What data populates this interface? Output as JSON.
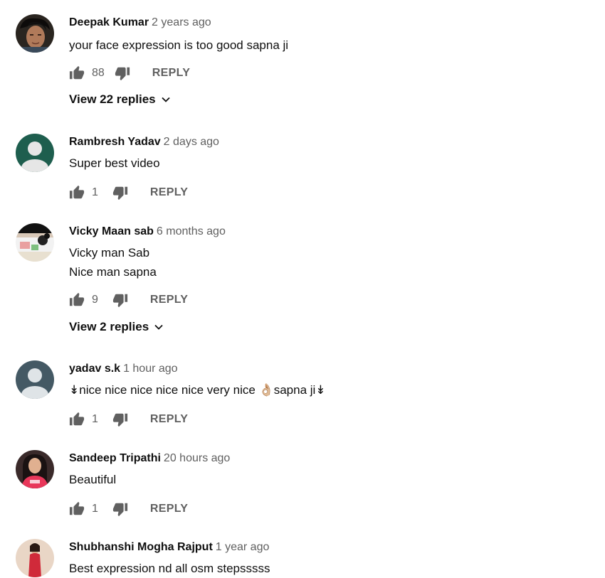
{
  "comments": [
    {
      "author": "Deepak Kumar",
      "time": "2 years ago",
      "lines": [
        "your face expression is too good  sapna ji"
      ],
      "likes": "88",
      "reply_label": "REPLY",
      "view_replies": "View 22 replies",
      "avatar_icon": "user-photo"
    },
    {
      "author": "Rambresh Yadav",
      "time": "2 days ago",
      "lines": [
        "Super best video"
      ],
      "likes": "1",
      "reply_label": "REPLY",
      "avatar_icon": "default-user-icon",
      "avatar_color": "#1e5e4e"
    },
    {
      "author": "Vicky Maan sab",
      "time": "6 months ago",
      "lines": [
        "Vicky man Sab",
        "Nice man sapna"
      ],
      "likes": "9",
      "reply_label": "REPLY",
      "view_replies": "View 2 replies",
      "avatar_icon": "user-photo"
    },
    {
      "author": "yadav s.k",
      "time": "1 hour ago",
      "lines": [
        "↡nice nice nice nice nice very nice 👌🏼sapna ji↡"
      ],
      "likes": "1",
      "reply_label": "REPLY",
      "avatar_icon": "default-user-icon",
      "avatar_color": "#445964"
    },
    {
      "author": "Sandeep Tripathi",
      "time": "20 hours ago",
      "lines": [
        "Beautiful"
      ],
      "likes": "1",
      "reply_label": "REPLY",
      "avatar_icon": "user-photo"
    },
    {
      "author": "Shubhanshi Mogha Rajput",
      "time": "1 year ago",
      "lines": [
        "Best expression nd all osm stepsssss"
      ],
      "avatar_icon": "user-photo"
    }
  ],
  "colors": {
    "text_primary": "#0f0f0f",
    "text_secondary": "#606060",
    "icon": "#606060"
  }
}
